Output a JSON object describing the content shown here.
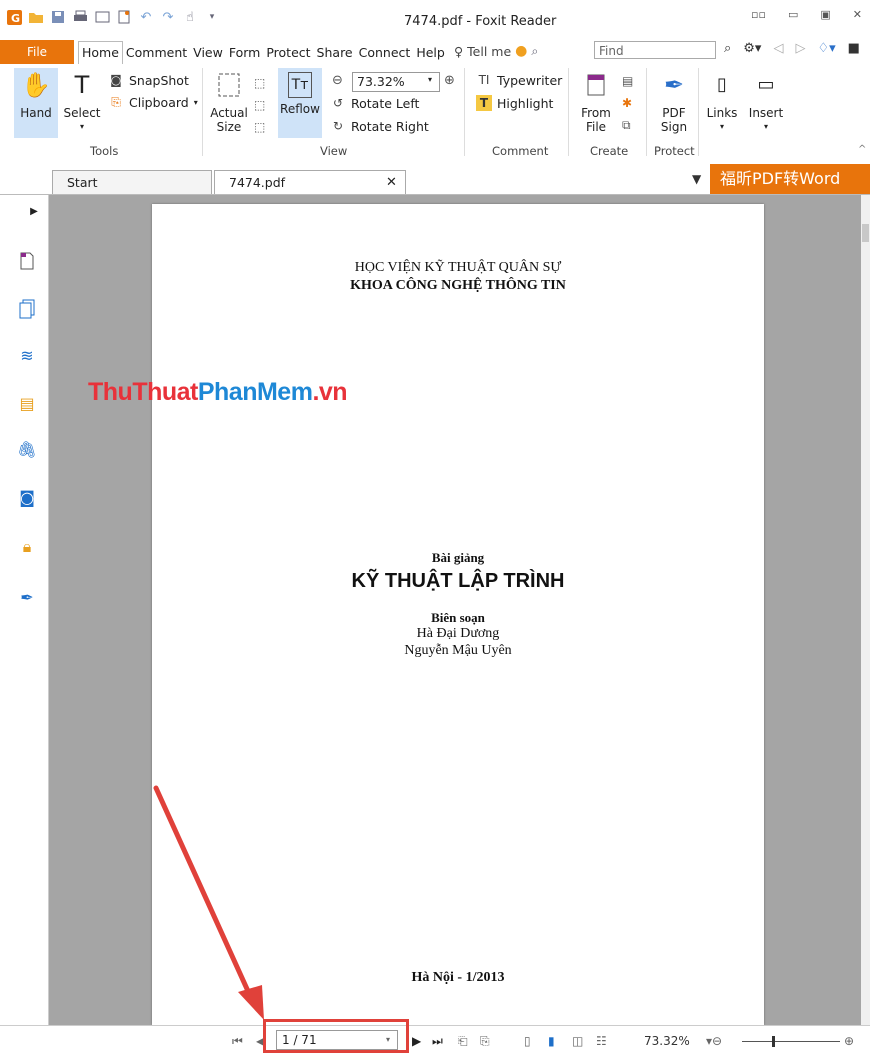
{
  "app": {
    "title": "7474.pdf - Foxit Reader"
  },
  "quick_access": [
    "foxit-logo-icon",
    "open-icon",
    "save-icon",
    "print-icon",
    "screen-icon",
    "new-icon",
    "undo-icon",
    "redo-icon",
    "hand-tool-icon"
  ],
  "menu": {
    "file": "File",
    "tabs": [
      "Home",
      "Comment",
      "View",
      "Form",
      "Protect",
      "Share",
      "Connect",
      "Help"
    ],
    "tell_me": "Tell me",
    "find_placeholder": "Find"
  },
  "ribbon": {
    "hand": "Hand",
    "select": "Select",
    "snapshot": "SnapShot",
    "clipboard": "Clipboard",
    "tools_label": "Tools",
    "actual_size_1": "Actual",
    "actual_size_2": "Size",
    "reflow": "Reflow",
    "zoom_value": "73.32%",
    "rotate_left": "Rotate Left",
    "rotate_right": "Rotate Right",
    "view_label": "View",
    "typewriter": "Typewriter",
    "highlight": "Highlight",
    "comment_label": "Comment",
    "from_file_1": "From",
    "from_file_2": "File",
    "create_label": "Create",
    "pdf_sign_1": "PDF",
    "pdf_sign_2": "Sign",
    "protect_label": "Protect",
    "links": "Links",
    "insert": "Insert"
  },
  "doc_tabs": {
    "start": "Start",
    "current": "7474.pdf"
  },
  "banner": "福昕PDF转Word",
  "document": {
    "institute": "HỌC VIỆN KỸ THUẬT QUÂN SỰ",
    "faculty": "KHOA CÔNG NGHỆ THÔNG TIN",
    "lecture_label": "Bài giảng",
    "course_title": "KỸ THUẬT LẬP TRÌNH",
    "editor_label": "Biên soạn",
    "author_1": "Hà Đại Dương",
    "author_2": "Nguyễn Mậu Uyên",
    "place_date": "Hà Nội - 1/2013"
  },
  "watermark": {
    "part1": "ThuThuat",
    "part2": "PhanMem",
    "part3": ".vn"
  },
  "status": {
    "page_indicator": "1 / 71",
    "zoom": "73.32%"
  },
  "colors": {
    "accent": "#e8740c",
    "annotation_red": "#e0413a",
    "ribbon_highlight": "#cfe3f8"
  }
}
